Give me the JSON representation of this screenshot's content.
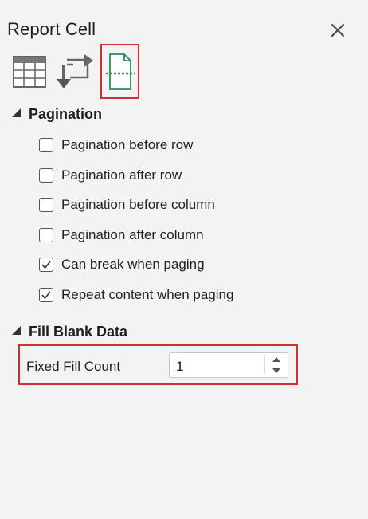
{
  "panel": {
    "title": "Report Cell"
  },
  "toolbar": {
    "icons": [
      "table-icon",
      "swap-icon",
      "page-break-icon"
    ],
    "selected": "page-break-icon"
  },
  "pagination": {
    "header": "Pagination",
    "options": [
      {
        "label": "Pagination before row",
        "checked": false
      },
      {
        "label": "Pagination after row",
        "checked": false
      },
      {
        "label": "Pagination before column",
        "checked": false
      },
      {
        "label": "Pagination after column",
        "checked": false
      },
      {
        "label": "Can break when paging",
        "checked": true
      },
      {
        "label": "Repeat content when paging",
        "checked": true
      }
    ]
  },
  "fill_blank": {
    "header": "Fill Blank Data",
    "fixed_fill_label": "Fixed Fill Count",
    "fixed_fill_value": "1"
  },
  "colors": {
    "highlight": "#d32f2f",
    "page_icon_green": "#2e8b57",
    "background": "#f3f3f3"
  }
}
